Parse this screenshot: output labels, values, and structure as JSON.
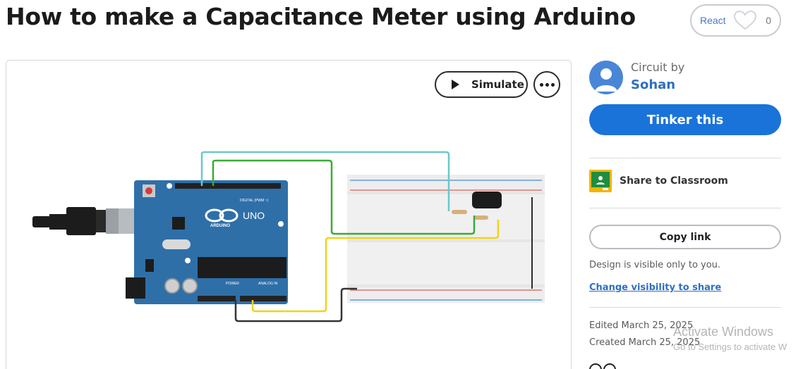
{
  "header": {
    "title": "How to make a Capacitance Meter using Arduino"
  },
  "react": {
    "label": "React",
    "count": "0",
    "icon": "heart-icon"
  },
  "canvas": {
    "simulate_label": "Simulate",
    "simulate_icon": "play-icon",
    "more_icon": "more-horizontal-icon",
    "board": {
      "brand": "ARDUINO",
      "model": "UNO",
      "digital_label": "DIGITAL (PWM ~)",
      "power_label": "POWER",
      "analog_label": "ANALOG IN"
    }
  },
  "sidebar": {
    "circuit_by": "Circuit by",
    "author": "Sohan",
    "avatar_icon": "user-avatar-icon",
    "tinker_label": "Tinker this",
    "classroom_label": "Share to Classroom",
    "classroom_icon": "google-classroom-icon",
    "copy_link_label": "Copy link",
    "visibility_note": "Design is visible only to you.",
    "change_visibility_label": "Change visibility to share",
    "edited": "Edited March 25, 2025",
    "created": "Created March 25, 2025"
  },
  "os_watermark": {
    "title": "Activate Windows",
    "subtitle": "Go to Settings to activate W"
  },
  "colors": {
    "accent": "#1a73d9",
    "link": "#2d6fc2",
    "arduino_board": "#2f6fa8",
    "wire_cyan": "#6cc7cc",
    "wire_green": "#3aaa35",
    "wire_yellow": "#f2d21b",
    "wire_black": "#333333"
  }
}
